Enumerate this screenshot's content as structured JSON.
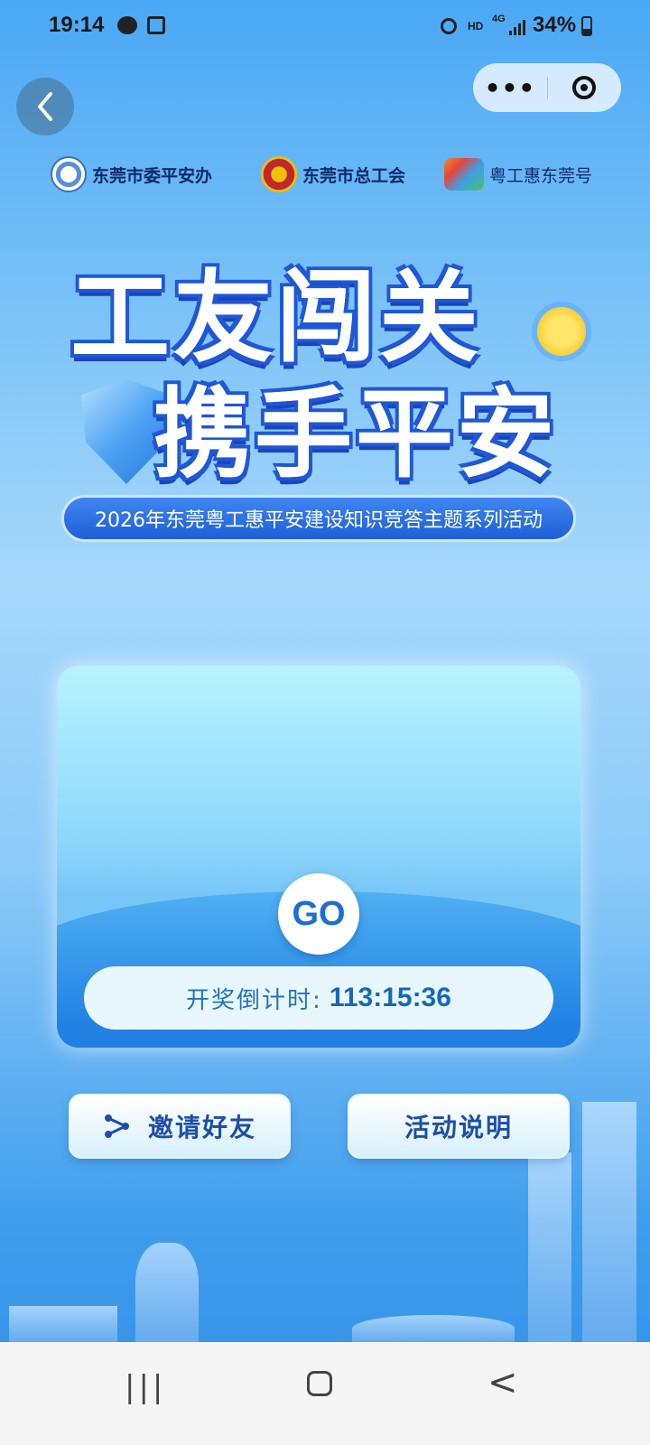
{
  "status_bar": {
    "time": "19:14",
    "hd": "HD",
    "network": "4G",
    "battery": "34%"
  },
  "header": {
    "back_icon": "chevron-left-icon",
    "more": "•••",
    "close_icon": "target-icon"
  },
  "sponsors": [
    {
      "name": "东莞市委平安办"
    },
    {
      "name": "东莞市总工会"
    },
    {
      "name": "粤工惠东莞号"
    }
  ],
  "title": {
    "line1": "工友闯关",
    "line2": "携手平安",
    "subtitle": "2026年东莞粤工惠平安建设知识竞答主题系列活动"
  },
  "game": {
    "go_label": "GO",
    "countdown_label": "开奖倒计时:",
    "countdown_value": "113:15:36"
  },
  "actions": {
    "invite_label": "邀请好友",
    "rules_label": "活动说明"
  },
  "nav": {
    "recent": "|||",
    "back": "<"
  },
  "colors": {
    "primary_blue": "#1f5fd6",
    "accent_yellow": "#fff3a8",
    "button_text": "#1d4fa8"
  }
}
